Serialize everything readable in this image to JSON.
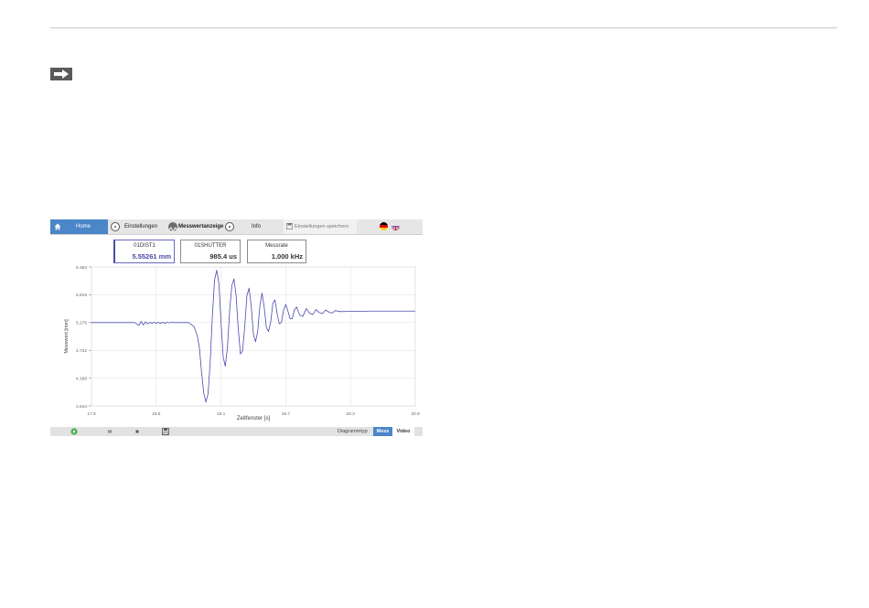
{
  "nav": {
    "home": "Home",
    "settings": "Einstellungen",
    "measurement": "Messwertanzeige",
    "info": "Info",
    "save_settings": "Einstellungen speichern"
  },
  "value_boxes": [
    {
      "title": "01DIST1",
      "value": "5.55261 mm"
    },
    {
      "title": "01SHUTTER",
      "value": "985.4 us"
    },
    {
      "title": "Messrate",
      "value": "1.000 kHz"
    }
  ],
  "bottom": {
    "diagram_type_label": "Diagrammtyp",
    "mode_mess": "Mess",
    "mode_video": "Video"
  },
  "colors": {
    "accent": "#4a86c8",
    "series": "#4a4ab0"
  },
  "chart_data": {
    "type": "line",
    "xlabel": "Zeitfenster [s]",
    "ylabel": "Messwert [mm]",
    "xlim": [
      17.9,
      20.9
    ],
    "ylim": [
      3.644,
      6.363
    ],
    "x_ticks": [
      "17.9",
      "18.5",
      "19.1",
      "19.7",
      "20.3",
      "20.9"
    ],
    "y_ticks": [
      "6.363",
      "5.819",
      "5.275",
      "4.732",
      "4.188",
      "3.644"
    ],
    "grid": true,
    "series": [
      {
        "x": [
          17.9,
          18.3,
          18.34,
          18.36,
          18.38,
          18.4,
          18.42,
          18.44,
          18.46,
          18.48,
          18.5,
          18.52,
          18.54,
          18.56,
          18.58,
          18.6,
          18.62,
          18.64,
          18.66,
          18.8,
          18.85,
          18.88,
          18.9,
          18.92,
          18.94,
          18.96,
          18.98,
          19.0,
          19.02,
          19.04,
          19.06,
          19.08,
          19.1,
          19.12,
          19.14,
          19.16,
          19.18,
          19.2,
          19.22,
          19.24,
          19.26,
          19.28,
          19.3,
          19.32,
          19.34,
          19.36,
          19.38,
          19.4,
          19.42,
          19.44,
          19.46,
          19.48,
          19.5,
          19.52,
          19.54,
          19.56,
          19.58,
          19.6,
          19.62,
          19.64,
          19.66,
          19.68,
          19.7,
          19.72,
          19.74,
          19.76,
          19.78,
          19.8,
          19.83,
          19.86,
          19.89,
          19.92,
          19.95,
          19.98,
          20.01,
          20.04,
          20.07,
          20.1,
          20.13,
          20.16,
          20.2,
          20.5,
          20.9
        ],
        "y": [
          5.275,
          5.275,
          5.22,
          5.3,
          5.23,
          5.29,
          5.25,
          5.28,
          5.26,
          5.28,
          5.26,
          5.28,
          5.26,
          5.28,
          5.26,
          5.28,
          5.27,
          5.28,
          5.275,
          5.275,
          5.2,
          5.02,
          4.78,
          4.3,
          3.9,
          3.72,
          3.88,
          4.5,
          5.4,
          6.1,
          6.3,
          6.05,
          5.3,
          4.6,
          4.42,
          4.8,
          5.5,
          6.0,
          6.13,
          5.8,
          5.15,
          4.66,
          4.72,
          5.2,
          5.8,
          5.95,
          5.6,
          5.05,
          4.9,
          5.1,
          5.6,
          5.85,
          5.58,
          5.18,
          5.1,
          5.28,
          5.65,
          5.72,
          5.45,
          5.25,
          5.28,
          5.52,
          5.63,
          5.5,
          5.35,
          5.35,
          5.52,
          5.58,
          5.42,
          5.4,
          5.55,
          5.46,
          5.43,
          5.53,
          5.47,
          5.45,
          5.52,
          5.48,
          5.46,
          5.51,
          5.49,
          5.5,
          5.5
        ]
      }
    ]
  }
}
